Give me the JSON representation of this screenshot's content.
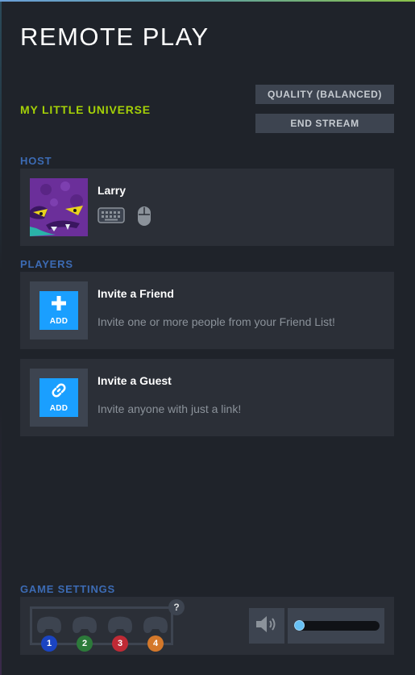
{
  "title": "REMOTE PLAY",
  "game_name": "MY LITTLE UNIVERSE",
  "buttons": {
    "quality": "QUALITY (BALANCED)",
    "end_stream": "END STREAM"
  },
  "host": {
    "section_label": "HOST",
    "name": "Larry",
    "icons": [
      "keyboard-icon",
      "mouse-icon"
    ]
  },
  "players": {
    "section_label": "PLAYERS",
    "invites": [
      {
        "icon": "plus-icon",
        "add_label": "ADD",
        "title": "Invite a Friend",
        "description": "Invite one or more people from your Friend List!"
      },
      {
        "icon": "link-icon",
        "add_label": "ADD",
        "title": "Invite a Guest",
        "description": "Invite anyone with just a link!"
      }
    ]
  },
  "game_settings": {
    "section_label": "GAME SETTINGS",
    "help": "?",
    "controller_slots": [
      {
        "number": "1",
        "color": "#1a44c2"
      },
      {
        "number": "2",
        "color": "#2c7a3a"
      },
      {
        "number": "3",
        "color": "#c02a35"
      },
      {
        "number": "4",
        "color": "#d4782a"
      }
    ],
    "volume_icon": "speaker-icon",
    "volume_level": 0
  },
  "colors": {
    "accent_green": "#a4d007",
    "section_blue": "#3c6bb4",
    "add_blue": "#1a9fff",
    "background": "#1f232a",
    "card": "#2b2f37"
  }
}
